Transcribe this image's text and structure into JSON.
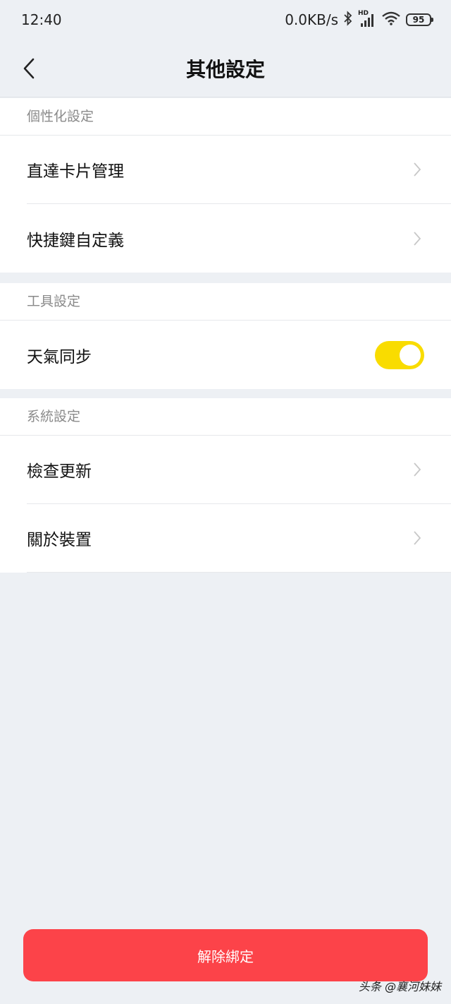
{
  "status_bar": {
    "time": "12:40",
    "network_speed": "0.0KB/s",
    "hd_label": "HD",
    "battery": "95",
    "icons": [
      "bluetooth-icon",
      "signal-icon",
      "wifi-icon",
      "battery-icon"
    ]
  },
  "nav": {
    "title": "其他設定",
    "back_icon": "chevron-left-icon"
  },
  "sections": {
    "personalization": {
      "header": "個性化設定",
      "items": [
        {
          "label": "直達卡片管理",
          "accessory": "chevron"
        },
        {
          "label": "快捷鍵自定義",
          "accessory": "chevron"
        }
      ]
    },
    "tools": {
      "header": "工具設定",
      "items": [
        {
          "label": "天氣同步",
          "accessory": "toggle",
          "enabled": true
        }
      ]
    },
    "system": {
      "header": "系統設定",
      "items": [
        {
          "label": "檢查更新",
          "accessory": "chevron"
        },
        {
          "label": "關於裝置",
          "accessory": "chevron"
        }
      ]
    }
  },
  "unbind_button": {
    "label": "解除綁定"
  },
  "watermark": "头条 @襄河妹妹",
  "colors": {
    "background": "#edf0f4",
    "toggle_on": "#f9dc00",
    "danger_button": "#fc4349"
  }
}
